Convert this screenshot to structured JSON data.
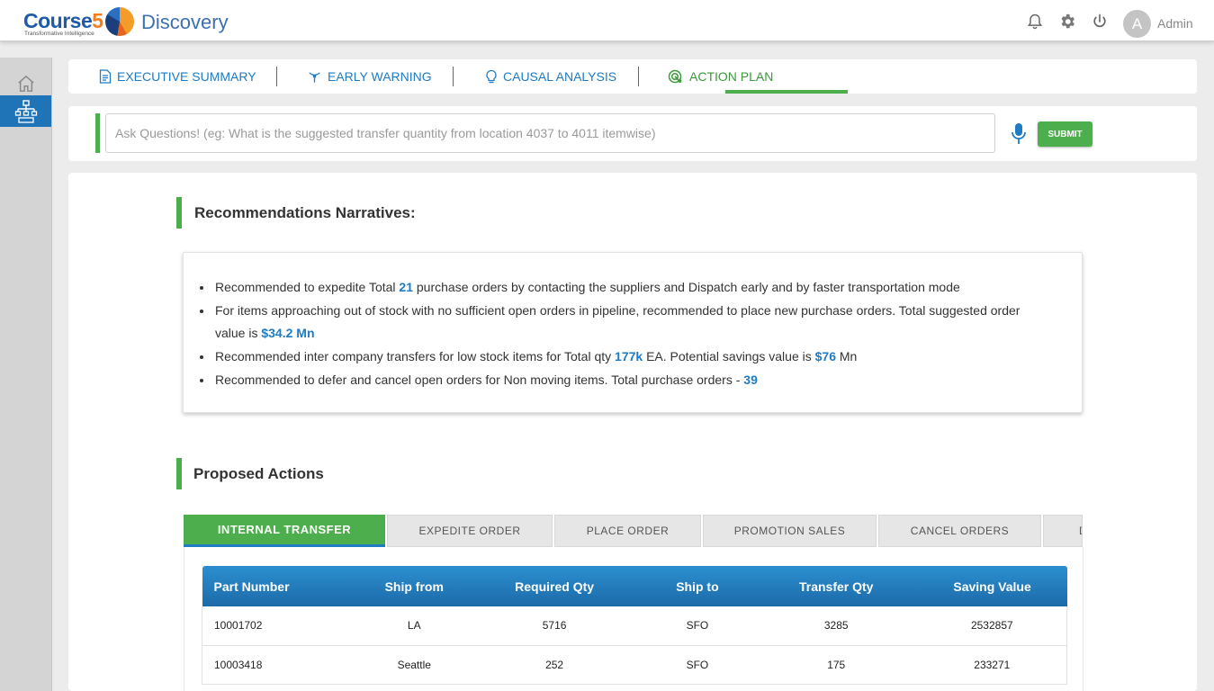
{
  "header": {
    "logo_brand": "Course",
    "logo_brand_digit": "5",
    "logo_tagline": "Transformative Intelligence",
    "app_name": "Discovery",
    "user_initial": "A",
    "user_name": "Admin",
    "icons": [
      "bell-icon",
      "gear-icon",
      "power-icon"
    ]
  },
  "sidebar": {
    "items": [
      {
        "icon": "home-icon",
        "active": false
      },
      {
        "icon": "network-icon",
        "active": true
      }
    ]
  },
  "tabs": [
    {
      "label": "EXECUTIVE SUMMARY",
      "icon": "document-icon"
    },
    {
      "label": "EARLY WARNING",
      "icon": "signal-icon"
    },
    {
      "label": "CAUSAL ANALYSIS",
      "icon": "lightbulb-icon"
    },
    {
      "label": "ACTION PLAN",
      "icon": "target-icon",
      "active": true
    }
  ],
  "ask": {
    "placeholder": "Ask Questions! (eg: What is the suggested transfer quantity from location 4037 to 4011 itemwise)",
    "submit_label": "SUBMIT"
  },
  "recommendations": {
    "title": "Recommendations Narratives:",
    "items": [
      {
        "pre": "Recommended to expedite Total ",
        "value": "21",
        "post": " purchase orders by contacting the suppliers and Dispatch early and by faster transportation mode"
      },
      {
        "pre": "For items approaching out of stock with no sufficient open orders in pipeline, recommended to place new purchase orders. Total suggested order value is ",
        "value": "$34.2 Mn",
        "post": ""
      },
      {
        "pre": "Recommended inter company transfers for low stock items for Total qty ",
        "value": "177k",
        "mid": " EA. Potential savings value is ",
        "value2": "$76",
        "post": " Mn"
      },
      {
        "pre": "Recommended to defer and cancel open orders for Non moving items. Total purchase orders - ",
        "value": "39",
        "post": ""
      }
    ]
  },
  "proposed": {
    "title": "Proposed Actions",
    "tabs": [
      "INTERNAL TRANSFER",
      "EXPEDITE ORDER",
      "PLACE ORDER",
      "PROMOTION SALES",
      "CANCEL ORDERS",
      "D"
    ],
    "active_tab": "INTERNAL TRANSFER",
    "columns": [
      "Part Number",
      "Ship from",
      "Required Qty",
      "Ship to",
      "Transfer Qty",
      "Saving Value"
    ],
    "rows": [
      [
        "10001702",
        "LA",
        "5716",
        "SFO",
        "3285",
        "2532857"
      ],
      [
        "10003418",
        "Seattle",
        "252",
        "SFO",
        "175",
        "233271"
      ]
    ]
  },
  "colors": {
    "accent_green": "#4cae4c",
    "accent_blue": "#1e7bc4",
    "sidebar_active": "#1f73b7"
  }
}
